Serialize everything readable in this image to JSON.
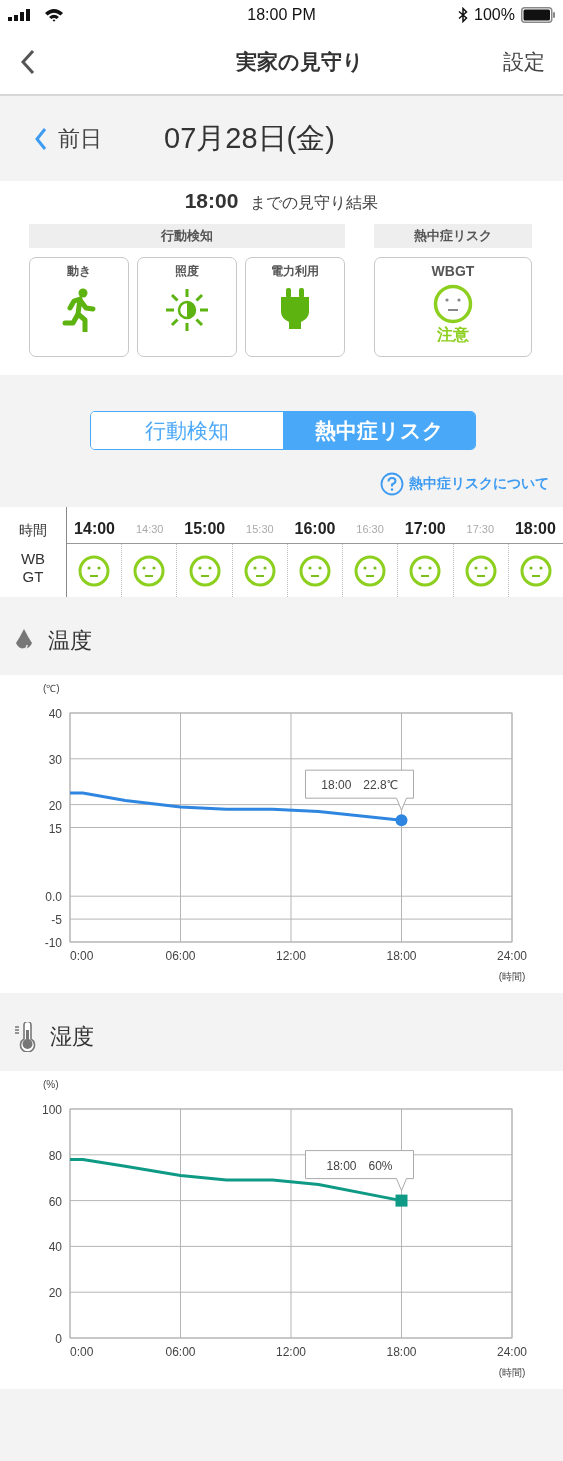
{
  "status_bar": {
    "time": "18:00 PM",
    "battery": "100%"
  },
  "nav": {
    "title": "実家の見守り",
    "right_button": "設定"
  },
  "date_bar": {
    "prev_label": "前日",
    "date": "07月28日(金)"
  },
  "summary": {
    "time": "18:00",
    "caption": "までの見守り結果",
    "groups": [
      {
        "title": "行動検知",
        "cards": [
          {
            "label": "動き",
            "kind": "motion"
          },
          {
            "label": "照度",
            "kind": "light"
          },
          {
            "label": "電力利用",
            "kind": "power"
          }
        ]
      },
      {
        "title": "熱中症リスク",
        "cards": [
          {
            "label": "WBGT",
            "kind": "risk",
            "status": "注意"
          }
        ]
      }
    ]
  },
  "segments": [
    {
      "label": "行動検知",
      "selected": false
    },
    {
      "label": "熱中症リスク",
      "selected": true
    }
  ],
  "help_link": "熱中症リスクについて",
  "timeline": {
    "time_label": "時間",
    "risk_label": "WB GT",
    "slots": [
      {
        "time": "14:00",
        "major": true
      },
      {
        "time": "14:30",
        "major": false
      },
      {
        "time": "15:00",
        "major": true
      },
      {
        "time": "15:30",
        "major": false
      },
      {
        "time": "16:00",
        "major": true
      },
      {
        "time": "16:30",
        "major": false
      },
      {
        "time": "17:00",
        "major": true
      },
      {
        "time": "17:30",
        "major": false
      },
      {
        "time": "18:00",
        "major": true
      }
    ]
  },
  "charts": [
    {
      "title": "温度",
      "unit": "(℃)",
      "x_unit": "(時間)",
      "tooltip": {
        "time": "18:00",
        "value": "22.8℃"
      },
      "chart_data": {
        "type": "line",
        "x": [
          0,
          0.7,
          3,
          6,
          8.5,
          11,
          13.5,
          18
        ],
        "series": [
          {
            "color": "#2f86e0",
            "values": [
              22.5,
              22.5,
              20.9,
              19.5,
              19.0,
              19.0,
              18.5,
              16.6
            ]
          }
        ],
        "grid": true,
        "xlim": [
          0,
          24
        ],
        "ylim": [
          -10,
          40
        ],
        "xticks": [
          {
            "value": 0,
            "label": "0:00"
          },
          {
            "value": 6,
            "label": "06:00"
          },
          {
            "value": 12,
            "label": "12:00"
          },
          {
            "value": 18,
            "label": "18:00"
          },
          {
            "value": 24,
            "label": "24:00"
          }
        ],
        "yticks": [
          {
            "value": 40,
            "label": "40"
          },
          {
            "value": 30,
            "label": "30"
          },
          {
            "value": 20,
            "label": "20"
          },
          {
            "value": 15,
            "label": "15"
          },
          {
            "value": 0,
            "label": "0.0"
          },
          {
            "value": -5,
            "label": "-5"
          },
          {
            "value": -10,
            "label": "-10"
          }
        ]
      }
    },
    {
      "title": "湿度",
      "unit": "(%)",
      "x_unit": "(時間)",
      "tooltip": {
        "time": "18:00",
        "value": "60%"
      },
      "chart_data": {
        "type": "line",
        "x": [
          0,
          0.7,
          3,
          6,
          8.5,
          11,
          13.5,
          18
        ],
        "series": [
          {
            "color": "#0f9a85",
            "values": [
              78,
              78,
              75,
              71,
              69,
              69,
              67,
              60
            ]
          }
        ],
        "grid": true,
        "xlim": [
          0,
          24
        ],
        "ylim": [
          0,
          100
        ],
        "xticks": [
          {
            "value": 0,
            "label": "0:00"
          },
          {
            "value": 6,
            "label": "06:00"
          },
          {
            "value": 12,
            "label": "12:00"
          },
          {
            "value": 18,
            "label": "18:00"
          },
          {
            "value": 24,
            "label": "24:00"
          }
        ],
        "yticks": [
          {
            "value": 100,
            "label": "100"
          },
          {
            "value": 80,
            "label": "80"
          },
          {
            "value": 60,
            "label": "60"
          },
          {
            "value": 40,
            "label": "40"
          },
          {
            "value": 20,
            "label": "20"
          },
          {
            "value": 0,
            "label": "0"
          }
        ]
      }
    }
  ]
}
